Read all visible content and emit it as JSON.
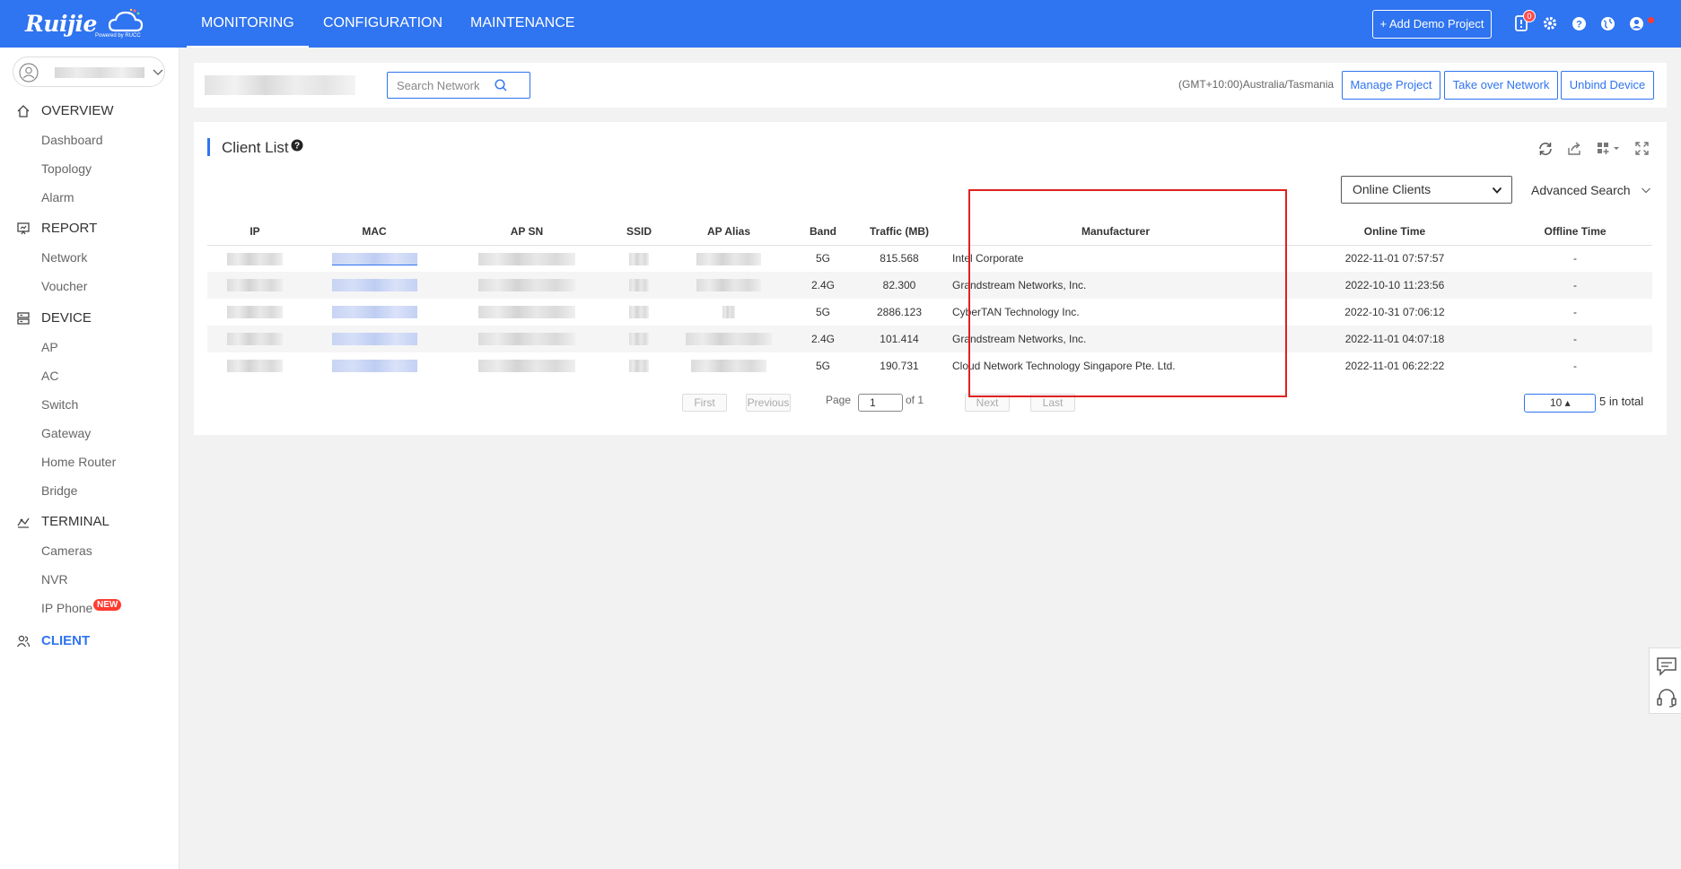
{
  "brand": {
    "logo_text": "Ruijie",
    "powered_by": "Powered by RUCC"
  },
  "nav": {
    "tabs": [
      "MONITORING",
      "CONFIGURATION",
      "MAINTENANCE"
    ]
  },
  "topbar": {
    "add_demo_label": "+ Add Demo Project",
    "notification_count": "0"
  },
  "sidebar": {
    "sections": [
      {
        "label": "OVERVIEW",
        "icon": "home-icon",
        "items": [
          "Dashboard",
          "Topology",
          "Alarm"
        ]
      },
      {
        "label": "REPORT",
        "icon": "report-icon",
        "items": [
          "Network",
          "Voucher"
        ]
      },
      {
        "label": "DEVICE",
        "icon": "device-icon",
        "items": [
          "AP",
          "AC",
          "Switch",
          "Gateway",
          "Home Router",
          "Bridge"
        ]
      },
      {
        "label": "TERMINAL",
        "icon": "terminal-icon",
        "items": [
          "Cameras",
          "NVR",
          "IP Phone"
        ]
      },
      {
        "label": "CLIENT",
        "icon": "client-icon",
        "items": []
      }
    ],
    "new_badge": "NEW"
  },
  "header": {
    "search_placeholder": "Search Network",
    "timezone": "(GMT+10:00)Australia/Tasmania",
    "buttons": [
      "Manage Project",
      "Take over Network",
      "Unbind Device"
    ]
  },
  "client_list": {
    "title": "Client List",
    "filter_value": "Online Clients",
    "advanced_search": "Advanced Search",
    "columns": [
      "IP",
      "MAC",
      "AP SN",
      "SSID",
      "AP Alias",
      "Band",
      "Traffic (MB)",
      "Manufacturer",
      "Online Time",
      "Offline Time"
    ],
    "rows": [
      {
        "band": "5G",
        "traffic": "815.568",
        "manufacturer": "Intel Corporate",
        "online": "2022-11-01 07:57:57",
        "offline": "-"
      },
      {
        "band": "2.4G",
        "traffic": "82.300",
        "manufacturer": "Grandstream Networks, Inc.",
        "online": "2022-10-10 11:23:56",
        "offline": "-"
      },
      {
        "band": "5G",
        "traffic": "2886.123",
        "manufacturer": "CyberTAN Technology Inc.",
        "online": "2022-10-31 07:06:12",
        "offline": "-"
      },
      {
        "band": "2.4G",
        "traffic": "101.414",
        "manufacturer": "Grandstream Networks, Inc.",
        "online": "2022-11-01 04:07:18",
        "offline": "-"
      },
      {
        "band": "5G",
        "traffic": "190.731",
        "manufacturer": "Cloud Network Technology Singapore Pte. Ltd.",
        "online": "2022-11-01 06:22:22",
        "offline": "-"
      }
    ],
    "pagination": {
      "first": "First",
      "previous": "Previous",
      "page_label": "Page",
      "page_value": "1",
      "of_label": "of 1",
      "next": "Next",
      "last": "Last",
      "page_size": "10 ▴",
      "total": "5 in total"
    }
  },
  "colors": {
    "accent": "#2f74f0",
    "highlight": "#e02020",
    "badge": "#ff3b30"
  }
}
